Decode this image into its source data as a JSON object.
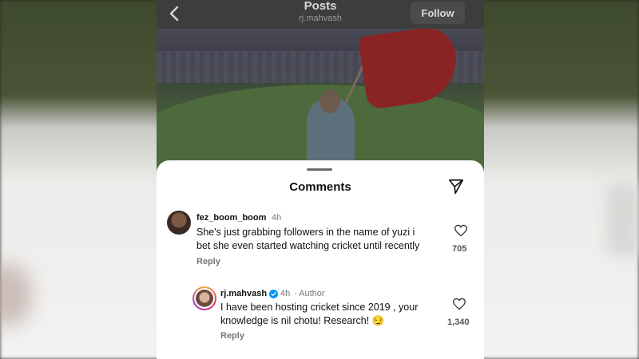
{
  "header": {
    "title": "Posts",
    "subtitle": "rj.mahvash",
    "follow_label": "Follow"
  },
  "comments_sheet": {
    "title": "Comments",
    "comments": [
      {
        "username": "fez_boom_boom",
        "time": "4h",
        "text_line1": "She's just grabbing followers in the name of yuzi i",
        "text_line2": "bet she even started watching cricket until recently",
        "reply_label": "Reply",
        "likes": "705"
      },
      {
        "username": "rj.mahvash",
        "time": "4h",
        "author_badge": "· Author",
        "text_line1": "I have been hosting cricket since 2019 , your",
        "text_line2": "knowledge is nil chotu! Research! 😏",
        "reply_label": "Reply",
        "likes": "1,340"
      }
    ]
  },
  "icons": {
    "back": "chevron-left-icon",
    "share": "send-icon",
    "like": "heart-icon",
    "verified": "verified-badge-icon"
  },
  "colors": {
    "verified_blue": "#0095f6",
    "topbar_bg": "#3d3d3d",
    "sheet_bg": "#ffffff"
  }
}
